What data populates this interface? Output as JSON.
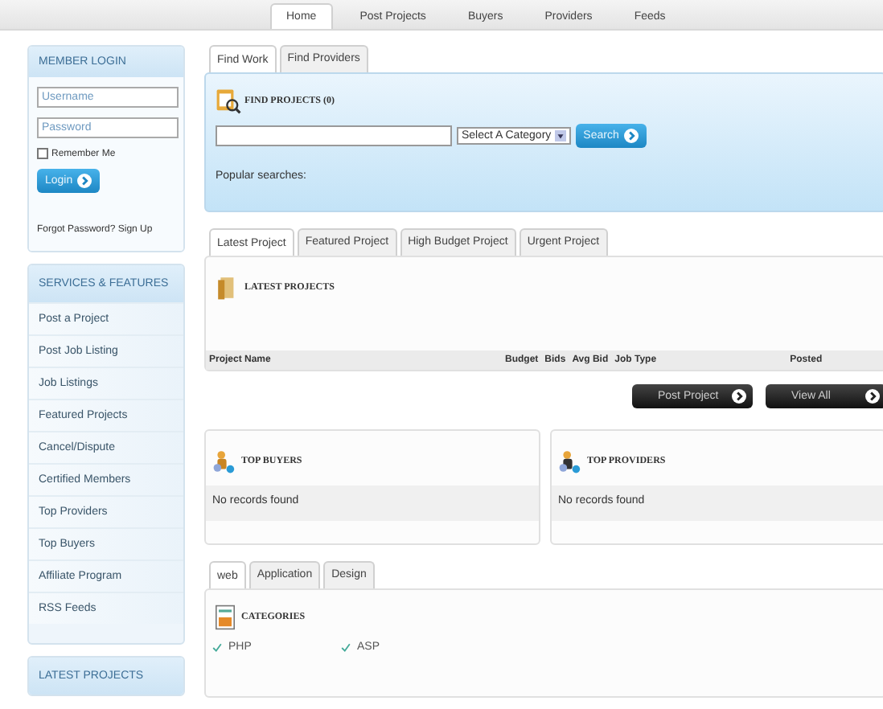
{
  "nav": [
    {
      "label": "Home",
      "selected": true
    },
    {
      "label": "Post Projects",
      "selected": false
    },
    {
      "label": "Buyers",
      "selected": false
    },
    {
      "label": "Providers",
      "selected": false
    },
    {
      "label": "Feeds",
      "selected": false
    }
  ],
  "login": {
    "title": "MEMBER LOGIN",
    "username_placeholder": "Username",
    "password_placeholder": "Password",
    "remember": {
      "label": "Remember Me",
      "checked": false
    },
    "button": "Login",
    "links": "Forgot Password? Sign Up"
  },
  "services": {
    "title": "SERVICES & FEATURES",
    "items": [
      "Post a Project",
      "Post Job Listing",
      "Job Listings",
      "Featured Projects",
      "Cancel/Dispute",
      "Certified Members",
      "Top Providers",
      "Top Buyers",
      "Affiliate Program",
      "RSS Feeds"
    ]
  },
  "latest_sidebar": {
    "title": "LATEST PROJECTS"
  },
  "search_tabs": [
    {
      "label": "Find Work",
      "selected": true
    },
    {
      "label": "Find Providers",
      "selected": false
    }
  ],
  "find": {
    "title": "FIND PROJECTS (0)",
    "category": "Select A Category",
    "button": "Search",
    "popular": "Popular searches:"
  },
  "project_tabs": [
    {
      "label": "Latest Project",
      "selected": true
    },
    {
      "label": "Featured Project",
      "selected": false
    },
    {
      "label": "High Budget Project",
      "selected": false
    },
    {
      "label": "Urgent Project",
      "selected": false
    }
  ],
  "latest": {
    "title": "LATEST PROJECTS",
    "columns": [
      "Project Name",
      "Budget",
      "Bids",
      "Avg Bid",
      "Job Type",
      "Posted"
    ]
  },
  "actions": [
    "Post Project",
    "View All"
  ],
  "top_buyers": {
    "title": "TOP BUYERS",
    "empty": "No records found"
  },
  "top_providers": {
    "title": "TOP PROVIDERS",
    "empty": "No records found"
  },
  "category_tabs": [
    {
      "label": "web",
      "selected": true
    },
    {
      "label": "Application",
      "selected": false
    },
    {
      "label": "Design",
      "selected": false
    }
  ],
  "categories": {
    "title": "CATEGORIES",
    "items": [
      "PHP",
      "ASP"
    ]
  }
}
